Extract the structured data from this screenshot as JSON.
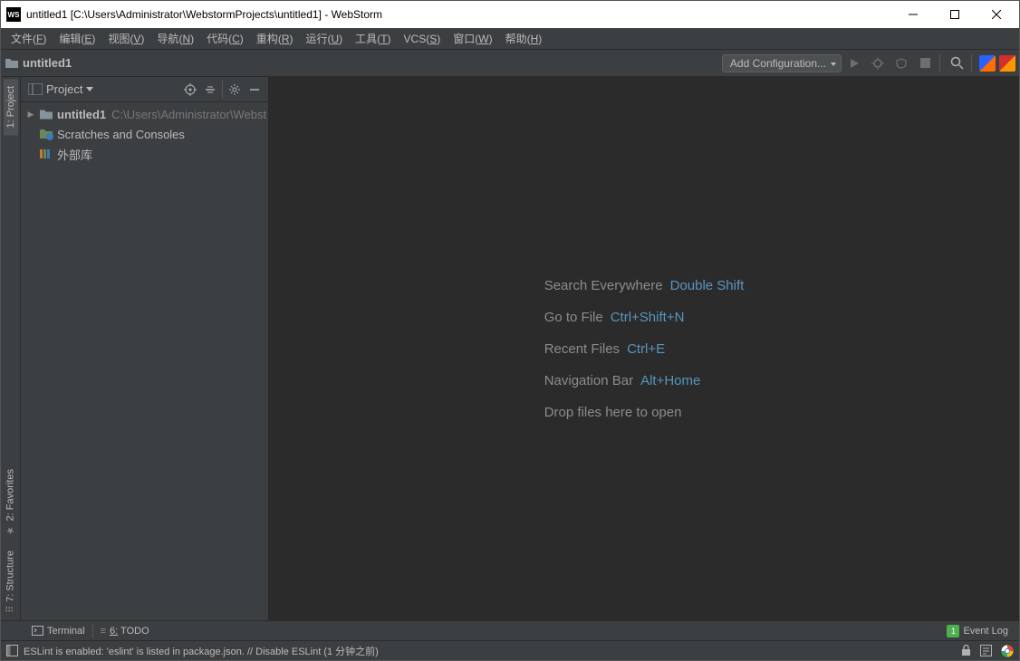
{
  "titlebar": {
    "logo": "WS",
    "title": "untitled1 [C:\\Users\\Administrator\\WebstormProjects\\untitled1] - WebStorm"
  },
  "menu": {
    "items": [
      {
        "label": "文件",
        "key": "F"
      },
      {
        "label": "编辑",
        "key": "E"
      },
      {
        "label": "视图",
        "key": "V"
      },
      {
        "label": "导航",
        "key": "N"
      },
      {
        "label": "代码",
        "key": "C"
      },
      {
        "label": "重构",
        "key": "R"
      },
      {
        "label": "运行",
        "key": "U"
      },
      {
        "label": "工具",
        "key": "T"
      },
      {
        "label": "VCS",
        "key": "S"
      },
      {
        "label": "窗口",
        "key": "W"
      },
      {
        "label": "帮助",
        "key": "H"
      }
    ]
  },
  "navbar": {
    "project": "untitled1",
    "add_config": "Add Configuration..."
  },
  "left_gutter": {
    "tabs": [
      {
        "label": "1: Project"
      },
      {
        "label": "2: Favorites"
      },
      {
        "label": "7: Structure"
      }
    ]
  },
  "project_panel": {
    "header_label": "Project",
    "tree": {
      "root": {
        "name": "untitled1",
        "path": "C:\\Users\\Administrator\\Webst"
      },
      "scratches": "Scratches and Consoles",
      "external": "外部库"
    }
  },
  "editor_hints": [
    {
      "label": "Search Everywhere",
      "shortcut": "Double Shift"
    },
    {
      "label": "Go to File",
      "shortcut": "Ctrl+Shift+N"
    },
    {
      "label": "Recent Files",
      "shortcut": "Ctrl+E"
    },
    {
      "label": "Navigation Bar",
      "shortcut": "Alt+Home"
    },
    {
      "label": "Drop files here to open",
      "shortcut": ""
    }
  ],
  "bottom_tools": {
    "terminal": "Terminal",
    "todo_num": "6:",
    "todo": "TODO",
    "event_log": "Event Log"
  },
  "statusbar": {
    "message": "ESLint is enabled: 'eslint' is listed in package.json. // Disable ESLint (1 分钟之前)"
  }
}
